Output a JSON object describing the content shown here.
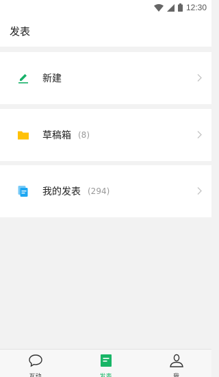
{
  "status_bar": {
    "time": "12:30",
    "icons": [
      "wifi-icon",
      "signal-icon",
      "battery-icon"
    ]
  },
  "header": {
    "title": "发表"
  },
  "menu": [
    {
      "label": "新建",
      "count": "",
      "icon": "pen-icon",
      "icon_color": "#17b169"
    },
    {
      "label": "草稿箱",
      "count": "(8)",
      "icon": "folder-icon",
      "icon_color": "#ffc107"
    },
    {
      "label": "我的发表",
      "count": "(294)",
      "icon": "documents-icon",
      "icon_color": "#1ea7f2"
    }
  ],
  "tab_bar": {
    "tabs": [
      {
        "label": "互动",
        "icon": "chat-bubble-icon",
        "active": false
      },
      {
        "label": "发表",
        "icon": "document-icon",
        "active": true
      },
      {
        "label": "我",
        "icon": "person-icon",
        "active": false
      }
    ]
  },
  "colors": {
    "accent": "#18b566",
    "background": "#f2f2f2"
  }
}
